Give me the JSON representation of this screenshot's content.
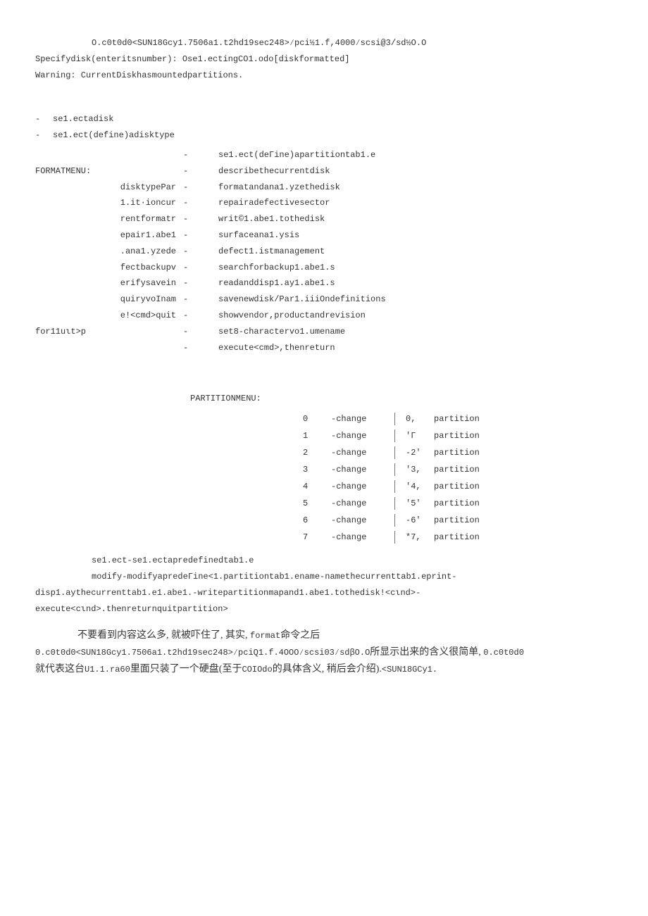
{
  "top": {
    "l1": "O.c0t0d0<SUN18Gcy1.7506a1.t2hd19sec248>∕pci½1.f,4000∕scsi@3/sd½O.O",
    "l2": "Specifydisk(enteritsnumber): Ose1.ectingCO1.odo[diskformatted]",
    "l3": "Warning: CurrentDiskhasmountedpartitions."
  },
  "sel": {
    "dash": "-",
    "a": "se1.ectadisk",
    "b": "se1.ect(define)adisktype"
  },
  "fmenu": {
    "left": {
      "head": "FORMATMENU:",
      "lines": [
        "disktypePar",
        "1.it·ioncur",
        "rentformatr",
        "epair1.abe1",
        ".ana1.yzede",
        "fectbackupv",
        "erifysavein",
        "quiryvoInam",
        "e!<cmd>quit"
      ],
      "last": "for11uιt>p"
    },
    "dash": "-",
    "right": [
      "se1.ect(deΓine)apartitiontab1.e",
      "describethecurrentdisk",
      "formatandana1.yzethedisk",
      "repairadefectivesector",
      "writ©1.abe1.tothedisk",
      "surfaceana1.ysis",
      "defect1.istmanagement",
      "searchforbackup1.abe1.s",
      "readanddisp1.ay1.abe1.s",
      "savenewdisk/Par1.iiiOndefinitions",
      "showvendor,productandrevision",
      "set8-charactervo1.umename",
      "execute<cmd>,thenreturn"
    ]
  },
  "pmenu": {
    "title": "PARTITIONMENU:",
    "rows": [
      {
        "n": "0",
        "c": "-change",
        "id": "0,",
        "w": "partition"
      },
      {
        "n": "1",
        "c": "-change",
        "id": "'Γ",
        "w": "partition"
      },
      {
        "n": "2",
        "c": "-change",
        "id": "-2'",
        "w": "partition"
      },
      {
        "n": "3",
        "c": "-change",
        "id": "'3,",
        "w": "partition"
      },
      {
        "n": "4",
        "c": "-change",
        "id": "'4,",
        "w": "partition"
      },
      {
        "n": "5",
        "c": "-change",
        "id": "'5'",
        "w": "partition"
      },
      {
        "n": "6",
        "c": "-change",
        "id": "-6'",
        "w": "partition"
      },
      {
        "n": "7",
        "c": "-change",
        "id": "*7,",
        "w": "partition"
      }
    ]
  },
  "para": {
    "l1": "se1.ect-se1.ectapredefinedtab1.e",
    "l2": "modify-modifyapredeΓine<1.partitiontab1.ename-namethecurrenttab1.eprint-",
    "l3": "disp1.aythecurrenttab1.e1.abe1.-writepartitionmapand1.abe1.tothedisk!<cιnd>-",
    "l4": "execute<cιnd>.thenreturnquitpartition>"
  },
  "cjk": {
    "p1_a": "不要看到内容这么多, 就被吓住了, 其实, ",
    "p1_b": "format",
    "p1_c": "命令之后",
    "p2_a": "0.c0t0d0<SUN18Gcy1.7506a1.t2hd19sec248>∕pciQ1.f.4OOO∕scsi03∕sdβO.O",
    "p2_b": "所显示出来的含义很简单, ",
    "p2_c": "0.c0t0d0",
    "p3_a": "就代表这台",
    "p3_b": "U1.1.ra60",
    "p3_c": "里面只装了一个硬盘(至于",
    "p3_d": "COIOdo",
    "p3_e": "的具体含义, 稍后会介绍).",
    "p3_f": "<SUN18GCy1."
  }
}
